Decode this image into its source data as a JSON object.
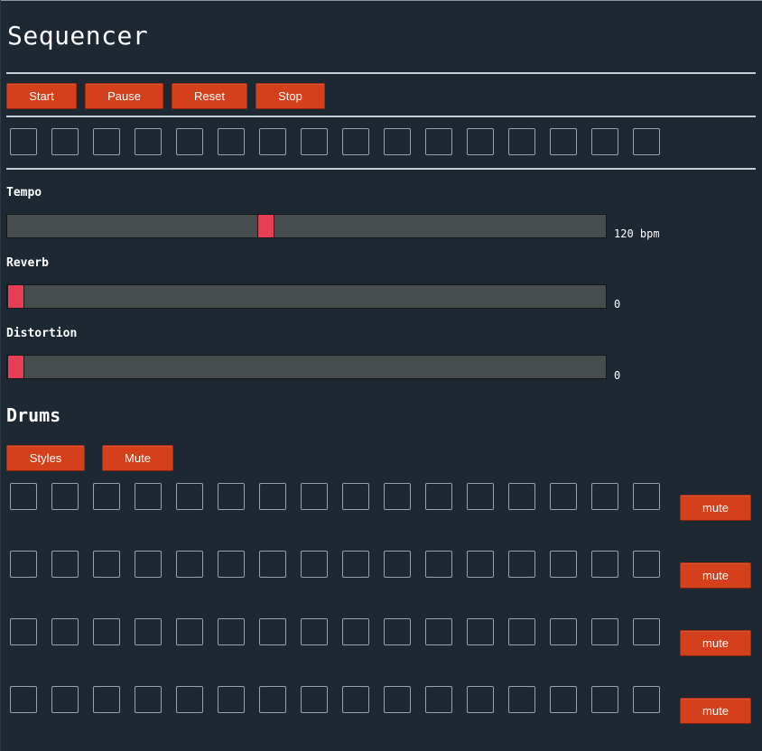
{
  "title": "Sequencer",
  "controls": {
    "start": "Start",
    "pause": "Pause",
    "reset": "Reset",
    "stop": "Stop"
  },
  "steps": 16,
  "sliders": [
    {
      "label": "Tempo",
      "value": "120 bpm",
      "level": 0.43
    },
    {
      "label": "Reverb",
      "value": "0",
      "level": 0
    },
    {
      "label": "Distortion",
      "value": "0",
      "level": 0
    }
  ],
  "drums": {
    "title": "Drums",
    "styles": "Styles",
    "mute": "Mute",
    "rows": [
      {
        "mute_label": "mute"
      },
      {
        "mute_label": "mute"
      },
      {
        "mute_label": "mute"
      },
      {
        "mute_label": "mute"
      }
    ]
  },
  "colors": {
    "background": "#1e2833",
    "button": "#d4401c",
    "thumb": "#e63e55",
    "track": "#474d4d"
  }
}
